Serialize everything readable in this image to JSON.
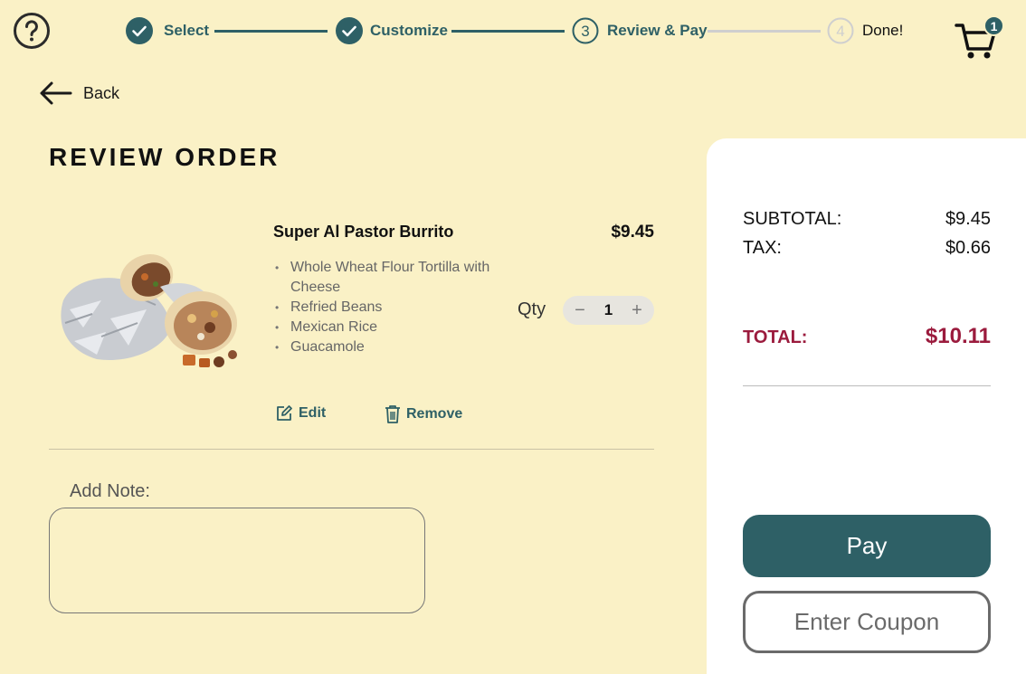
{
  "steps": [
    {
      "number": "1",
      "label": "Select",
      "state": "done"
    },
    {
      "number": "2",
      "label": "Customize",
      "state": "done"
    },
    {
      "number": "3",
      "label": "Review & Pay",
      "state": "current"
    },
    {
      "number": "4",
      "label": "Done!",
      "state": "future"
    }
  ],
  "cart": {
    "count": "1"
  },
  "nav": {
    "back_label": "Back"
  },
  "page": {
    "title": "REVIEW ORDER"
  },
  "item": {
    "name": "Super Al Pastor Burrito",
    "price": "$9.45",
    "ingredients": [
      "Whole Wheat Flour Tortilla with Cheese",
      "Refried Beans",
      "Mexican Rice",
      "Guacamole"
    ],
    "qty_label": "Qty",
    "qty_value": "1",
    "edit_label": "Edit",
    "remove_label": "Remove"
  },
  "note": {
    "label": "Add Note:",
    "value": ""
  },
  "summary": {
    "subtotal_label": "SUBTOTAL:",
    "subtotal_value": "$9.45",
    "tax_label": "TAX:",
    "tax_value": "$0.66",
    "total_label": "TOTAL:",
    "total_value": "$10.11"
  },
  "actions": {
    "pay_label": "Pay",
    "coupon_label": "Enter Coupon"
  },
  "colors": {
    "accent": "#2e6066",
    "background": "#faf1c6",
    "total": "#9b1b3d"
  }
}
